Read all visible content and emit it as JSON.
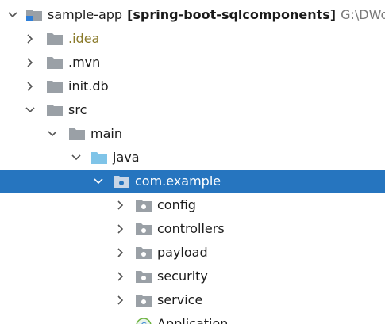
{
  "project_tree": {
    "root": {
      "name": "sample-app",
      "module": "[spring-boot-sqlcomponents]",
      "path": "G:\\DWor",
      "icon": "module-folder-icon"
    },
    "items": [
      {
        "label": ".idea",
        "icon": "folder-icon",
        "expanded": false
      },
      {
        "label": ".mvn",
        "icon": "folder-icon",
        "expanded": false
      },
      {
        "label": "init.db",
        "icon": "folder-icon",
        "expanded": false
      },
      {
        "label": "src",
        "icon": "folder-icon",
        "expanded": true
      },
      {
        "label": "main",
        "icon": "folder-icon",
        "expanded": true
      },
      {
        "label": "java",
        "icon": "source-root-folder-icon",
        "expanded": true
      },
      {
        "label": "com.example",
        "icon": "package-icon",
        "expanded": true,
        "selected": true
      },
      {
        "label": "config",
        "icon": "package-icon",
        "expanded": false
      },
      {
        "label": "controllers",
        "icon": "package-icon",
        "expanded": false
      },
      {
        "label": "payload",
        "icon": "package-icon",
        "expanded": false
      },
      {
        "label": "security",
        "icon": "package-icon",
        "expanded": false
      },
      {
        "label": "service",
        "icon": "package-icon",
        "expanded": false
      },
      {
        "label": "Application",
        "icon": "spring-boot-class-icon"
      }
    ]
  },
  "colors": {
    "selection": "#2675bf",
    "folder": "#9aa0a6",
    "source_root": "#7fc4e8",
    "spring": "#6db33f"
  }
}
